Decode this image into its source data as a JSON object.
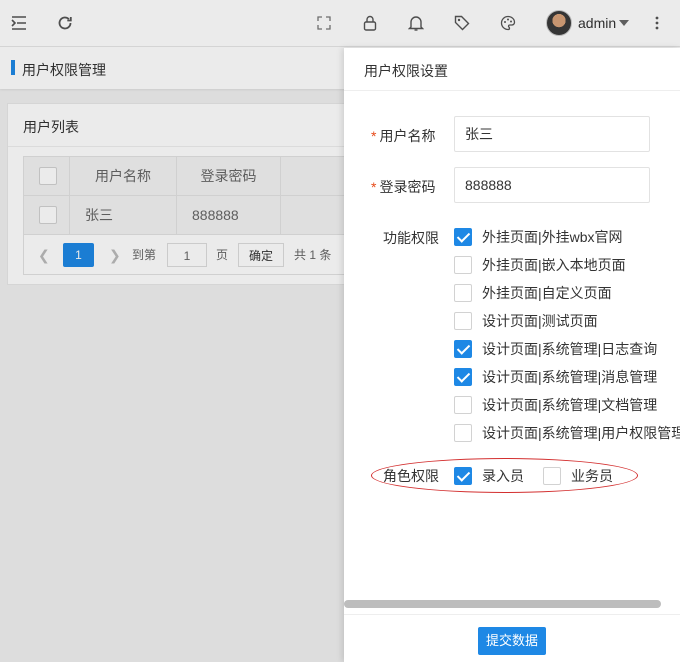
{
  "header": {
    "user_name": "admin",
    "icons": [
      "menu-fold-icon",
      "refresh-icon",
      "fullscreen-icon",
      "lock-icon",
      "bell-icon",
      "tag-icon",
      "palette-icon",
      "more-icon"
    ]
  },
  "breadcrumb": {
    "title": "用户权限管理"
  },
  "card": {
    "title": "用户列表",
    "columns": [
      "用户名称",
      "登录密码"
    ],
    "rows": [
      {
        "name": "张三",
        "password": "888888"
      }
    ]
  },
  "pager": {
    "current_page": "1",
    "goto_label": "到第",
    "goto_value": "1",
    "page_unit": "页",
    "confirm": "确定",
    "total": "共 1 条"
  },
  "panel": {
    "title": "用户权限设置",
    "username_label": "用户名称",
    "username_value": "张三",
    "password_label": "登录密码",
    "password_value": "888888",
    "function_label": "功能权限",
    "functions": [
      {
        "label": "外挂页面|外挂wbx官网",
        "checked": true
      },
      {
        "label": "外挂页面|嵌入本地页面",
        "checked": false
      },
      {
        "label": "外挂页面|自定义页面",
        "checked": false
      },
      {
        "label": "设计页面|测试页面",
        "checked": false
      },
      {
        "label": "设计页面|系统管理|日志查询",
        "checked": true
      },
      {
        "label": "设计页面|系统管理|消息管理",
        "checked": true
      },
      {
        "label": "设计页面|系统管理|文档管理",
        "checked": false
      },
      {
        "label": "设计页面|系统管理|用户权限管理",
        "checked": false
      }
    ],
    "role_label": "角色权限",
    "roles": [
      {
        "label": "录入员",
        "checked": true
      },
      {
        "label": "业务员",
        "checked": false
      }
    ],
    "submit": "提交数据"
  },
  "colors": {
    "accent": "#1e88e5",
    "highlight_ellipse": "#d32f2f"
  }
}
